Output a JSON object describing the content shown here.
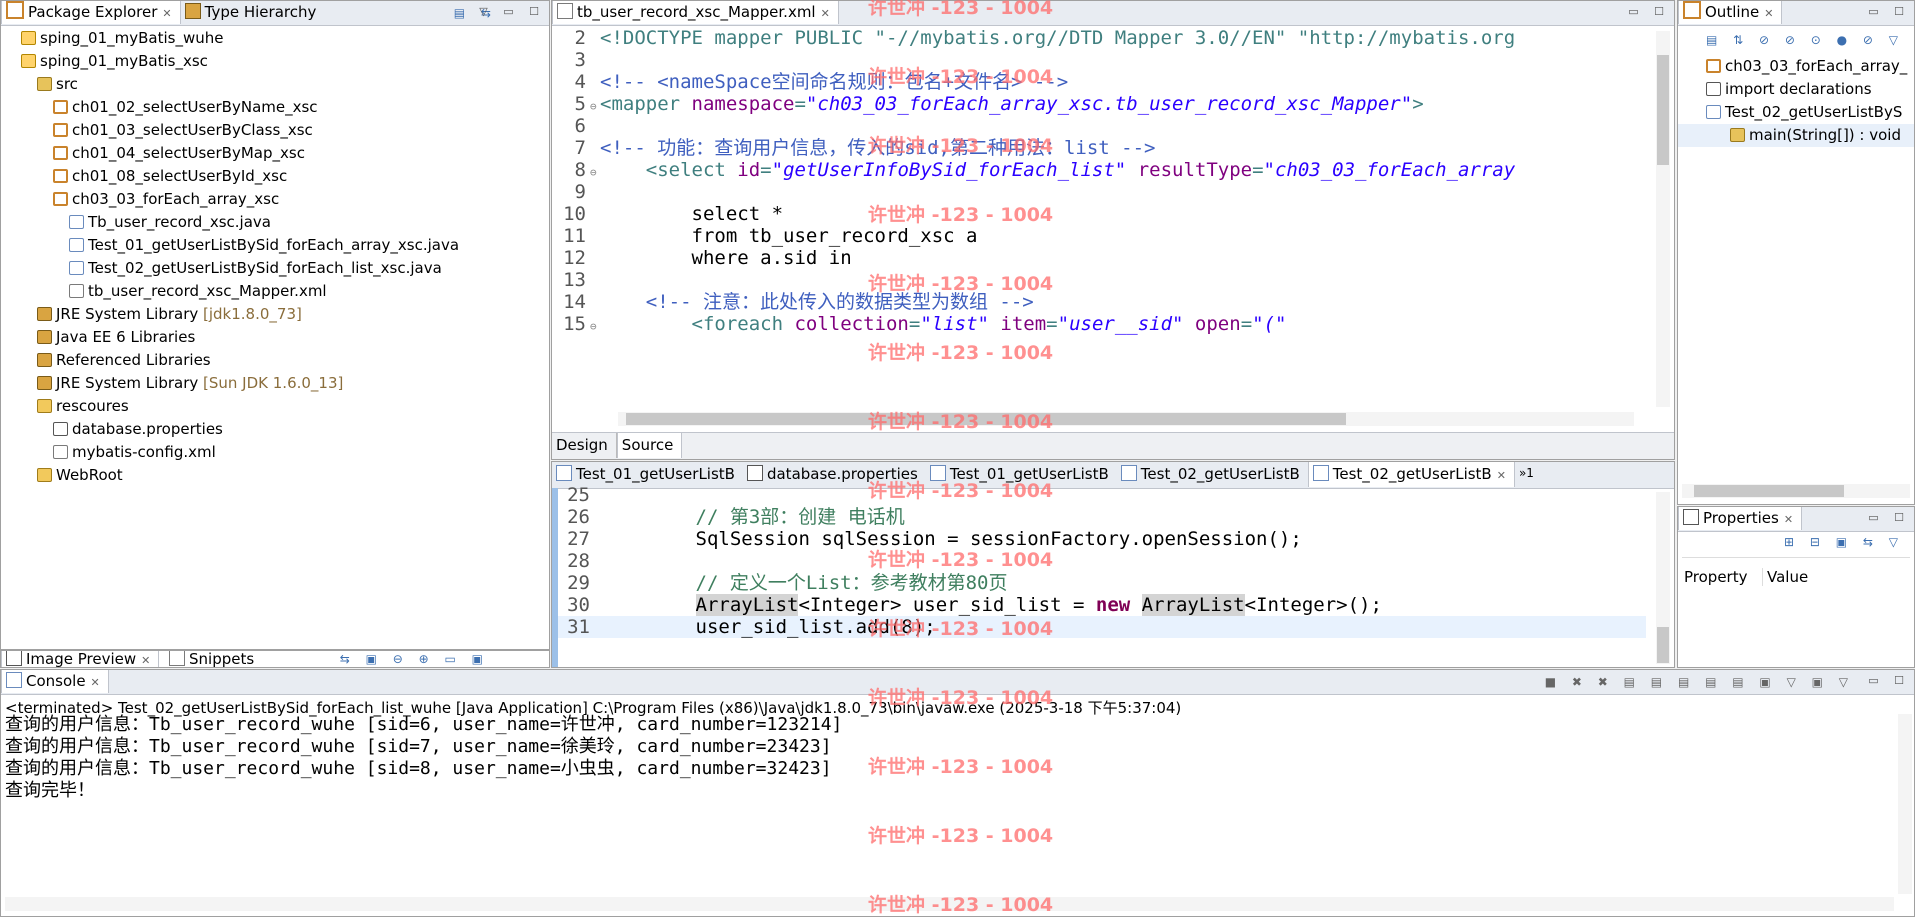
{
  "package_explorer": {
    "tabs": [
      "Package Explorer",
      "Type Hierarchy"
    ],
    "tree": [
      {
        "label": "sping_01_myBatis_wuhe",
        "icon": "project",
        "level": 0
      },
      {
        "label": "sping_01_myBatis_xsc",
        "icon": "project",
        "level": 0
      },
      {
        "label": "src",
        "icon": "source-folder",
        "level": 1
      },
      {
        "label": "ch01_02_selectUserByName_xsc",
        "icon": "package",
        "level": 2
      },
      {
        "label": "ch01_03_selectUserByClass_xsc",
        "icon": "package",
        "level": 2
      },
      {
        "label": "ch01_04_selectUserByMap_xsc",
        "icon": "package",
        "level": 2
      },
      {
        "label": "ch01_08_selectUserById_xsc",
        "icon": "package",
        "level": 2
      },
      {
        "label": "ch03_03_forEach_array_xsc",
        "icon": "package",
        "level": 2
      },
      {
        "label": "Tb_user_record_xsc.java",
        "icon": "java-file",
        "level": 3
      },
      {
        "label": "Test_01_getUserListBySid_forEach_array_xsc.java",
        "icon": "java-file",
        "level": 3
      },
      {
        "label": "Test_02_getUserListBySid_forEach_list_xsc.java",
        "icon": "java-file",
        "level": 3
      },
      {
        "label": "tb_user_record_xsc_Mapper.xml",
        "icon": "xml-file",
        "level": 3
      },
      {
        "label": "JRE System Library",
        "suffix": "[jdk1.8.0_73]",
        "icon": "library",
        "level": 1
      },
      {
        "label": "Java EE 6 Libraries",
        "icon": "library",
        "level": 1
      },
      {
        "label": "Referenced Libraries",
        "icon": "library",
        "level": 1
      },
      {
        "label": "JRE System Library",
        "suffix": "[Sun JDK 1.6.0_13]",
        "icon": "library",
        "level": 1
      },
      {
        "label": "rescoures",
        "icon": "folder",
        "level": 1
      },
      {
        "label": "database.properties",
        "icon": "properties-file",
        "level": 2
      },
      {
        "label": "mybatis-config.xml",
        "icon": "xml-file",
        "level": 2
      },
      {
        "label": "WebRoot",
        "icon": "folder",
        "level": 1
      }
    ]
  },
  "xml_editor": {
    "tab": "tb_user_record_xsc_Mapper.xml",
    "bottom_tabs": [
      "Design",
      "Source"
    ],
    "lines": [
      {
        "n": "2",
        "fold": "",
        "parts": [
          [
            "tag",
            "<!DOCTYPE mapper PUBLIC \""
          ],
          [
            "str2",
            "-//mybatis.org//DTD Mapper 3.0//EN"
          ],
          [
            "tag",
            "\" \"http://mybatis.org"
          ]
        ]
      },
      {
        "n": "3",
        "fold": "",
        "parts": []
      },
      {
        "n": "4",
        "fold": "",
        "parts": [
          [
            "cmt",
            "<!-- <nameSpace空间命名规则：包名+文件名> -->"
          ]
        ]
      },
      {
        "n": "5",
        "fold": "⊖",
        "parts": [
          [
            "tag",
            "<mapper "
          ],
          [
            "attr",
            "namespace"
          ],
          [
            "tag",
            "="
          ],
          [
            "str",
            "\"ch03_03_forEach_array_xsc.tb_user_record_xsc_Mapper\""
          ],
          [
            "tag",
            ">"
          ]
        ]
      },
      {
        "n": "6",
        "fold": "",
        "parts": []
      },
      {
        "n": "7",
        "fold": "",
        "parts": [
          [
            "cmt",
            "<!-- 功能：查询用户信息，传入的sid,第二种用法：list -->"
          ]
        ]
      },
      {
        "n": "8",
        "fold": "⊖",
        "parts": [
          [
            "plain",
            "    "
          ],
          [
            "tag",
            "<select "
          ],
          [
            "attr",
            "id"
          ],
          [
            "tag",
            "="
          ],
          [
            "str",
            "\"getUserInfoBySid_forEach_list\""
          ],
          [
            "plain",
            " "
          ],
          [
            "attr",
            "resultType"
          ],
          [
            "tag",
            "="
          ],
          [
            "str",
            "\"ch03_03_forEach_array"
          ]
        ]
      },
      {
        "n": "9",
        "fold": "",
        "parts": []
      },
      {
        "n": "10",
        "fold": "",
        "parts": [
          [
            "plain",
            "        select *"
          ]
        ]
      },
      {
        "n": "11",
        "fold": "",
        "parts": [
          [
            "plain",
            "        from tb_user_record_xsc a"
          ]
        ]
      },
      {
        "n": "12",
        "fold": "",
        "parts": [
          [
            "plain",
            "        where a.sid in"
          ]
        ]
      },
      {
        "n": "13",
        "fold": "",
        "parts": []
      },
      {
        "n": "14",
        "fold": "",
        "parts": [
          [
            "plain",
            "    "
          ],
          [
            "cmt",
            "<!-- 注意：此处传入的数据类型为数组 -->"
          ]
        ]
      },
      {
        "n": "15",
        "fold": "⊖",
        "parts": [
          [
            "plain",
            "        "
          ],
          [
            "tag",
            "<foreach "
          ],
          [
            "attr",
            "collection"
          ],
          [
            "tag",
            "="
          ],
          [
            "str",
            "\"list\""
          ],
          [
            "plain",
            " "
          ],
          [
            "attr",
            "item"
          ],
          [
            "tag",
            "="
          ],
          [
            "str",
            "\"user__sid\""
          ],
          [
            "plain",
            " "
          ],
          [
            "attr",
            "open"
          ],
          [
            "tag",
            "="
          ],
          [
            "str",
            "\"(\""
          ]
        ]
      }
    ]
  },
  "java_editor": {
    "tabs": [
      "Test_01_getUserListB",
      "database.properties",
      "Test_01_getUserListB",
      "Test_02_getUserListB",
      "Test_02_getUserListB"
    ],
    "overflow": "»1",
    "lines": [
      {
        "n": "25",
        "parts": []
      },
      {
        "n": "26",
        "parts": [
          [
            "jcmt",
            "        // 第3部：创建 电话机"
          ]
        ]
      },
      {
        "n": "27",
        "parts": [
          [
            "plain",
            "        SqlSession sqlSession = sessionFactory.openSession();"
          ]
        ]
      },
      {
        "n": "28",
        "parts": []
      },
      {
        "n": "29",
        "parts": [
          [
            "jcmt",
            "        // 定义一个List：参考教材第80页"
          ]
        ]
      },
      {
        "n": "30",
        "parts": [
          [
            "plain",
            "        "
          ],
          [
            "hl",
            "ArrayList"
          ],
          [
            "plain",
            "<Integer> user_sid_list = "
          ],
          [
            "kw",
            "new"
          ],
          [
            "plain",
            " "
          ],
          [
            "hl",
            "ArrayList"
          ],
          [
            "plain",
            "<Integer>();"
          ]
        ]
      },
      {
        "n": "31",
        "parts": [
          [
            "plain",
            "        user_sid_list.add(8);"
          ]
        ],
        "current": true
      }
    ]
  },
  "outline": {
    "tab": "Outline",
    "items": [
      {
        "label": "ch03_03_forEach_array_",
        "icon": "package",
        "level": 0
      },
      {
        "label": "import declarations",
        "icon": "imports",
        "level": 0
      },
      {
        "label": "Test_02_getUserListByS",
        "icon": "class",
        "level": 0
      },
      {
        "label": "main(String[]) : void",
        "icon": "method",
        "level": 1
      }
    ]
  },
  "properties": {
    "tab": "Properties",
    "columns": [
      "Property",
      "Value"
    ]
  },
  "image_preview": {
    "tabs": [
      "Image Preview",
      "Snippets"
    ]
  },
  "console": {
    "tab": "Console",
    "status": "<terminated> Test_02_getUserListBySid_forEach_list_wuhe [Java Application] C:\\Program Files (x86)\\Java\\jdk1.8.0_73\\bin\\javaw.exe (2025-3-18 下午5:37:04)",
    "lines": [
      "查询的用户信息：Tb_user_record_wuhe [sid=6, user_name=许世冲, card_number=123214]",
      "查询的用户信息：Tb_user_record_wuhe [sid=7, user_name=徐美玲, card_number=23423]",
      "查询的用户信息：Tb_user_record_wuhe [sid=8, user_name=小虫虫, card_number=32423]",
      "查询完毕！"
    ]
  },
  "watermark": "许世冲 -123 - 1004",
  "colors": {
    "keyword": "#7f0055",
    "xml_tag": "#3f7f7f",
    "xml_attr": "#7f007f",
    "string": "#2a00ff",
    "comment": "#3f5fbf",
    "watermark": "#ff6b6b"
  }
}
